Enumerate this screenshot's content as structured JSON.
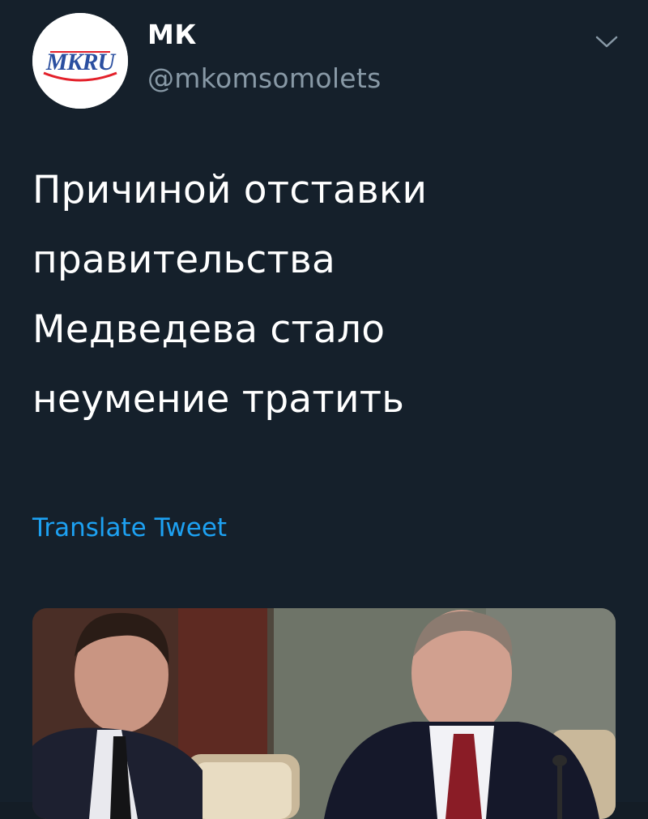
{
  "tweet": {
    "author": {
      "name": "МК",
      "handle": "@mkomsomolets",
      "avatar_text": "MKRU",
      "avatar_text_color": "#2b4fa0",
      "avatar_accent_color": "#e3202a"
    },
    "text_lines": [
      "Причиной отставки",
      "правительства",
      "Медведева стало",
      "неумение тратить"
    ],
    "translate_label": "Translate Tweet",
    "menu_icon": "chevron-down-icon",
    "media_description": "photo"
  },
  "colors": {
    "background": "#15202b",
    "primary_text": "#ffffff",
    "secondary_text": "#8899a6",
    "link": "#1da1f2"
  }
}
